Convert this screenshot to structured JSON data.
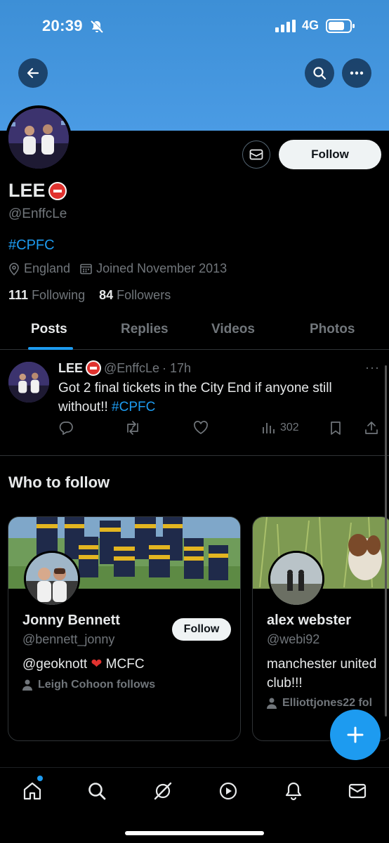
{
  "status_bar": {
    "time": "20:39",
    "network": "4G"
  },
  "profile": {
    "name": "LEE",
    "handle": "@EnffcLe",
    "bio": "#CPFC",
    "location": "England",
    "joined": "Joined November 2013",
    "following_count": "111",
    "following_label": "Following",
    "followers_count": "84",
    "followers_label": "Followers",
    "follow_label": "Follow"
  },
  "tabs": [
    {
      "label": "Posts",
      "active": true
    },
    {
      "label": "Replies",
      "active": false
    },
    {
      "label": "Videos",
      "active": false
    },
    {
      "label": "Photos",
      "active": false
    }
  ],
  "post": {
    "author": "LEE",
    "handle": "@EnffcLe",
    "time": "· 17h",
    "text_main": "Got 2 final tickets in the City End if anyone still without!!",
    "text_tag": "#CPFC",
    "views": "302"
  },
  "who_to_follow": {
    "title": "Who to follow",
    "cards": [
      {
        "name": "Jonny Bennett",
        "handle": "@bennett_jonny",
        "bio_a": "@geoknott",
        "bio_b": "MCFC",
        "social": "Leigh Cohoon follows",
        "follow_label": "Follow"
      },
      {
        "name": "alex webster",
        "handle": "@webi92",
        "bio": "manchester united club!!!",
        "social": "Elliottjones22 fol"
      }
    ]
  },
  "colors": {
    "accent": "#1d9bf0",
    "banner": "#4a9be4",
    "background": "#000000",
    "muted": "#71767b"
  },
  "icons": [
    "back-arrow-icon",
    "search-icon",
    "more-icon",
    "mail-icon",
    "location-icon",
    "calendar-icon",
    "reply-icon",
    "repost-icon",
    "like-icon",
    "views-icon",
    "bookmark-icon",
    "share-icon",
    "person-icon",
    "plus-icon",
    "home-icon",
    "explore-icon",
    "grok-icon",
    "play-icon",
    "bell-icon",
    "messages-icon"
  ]
}
